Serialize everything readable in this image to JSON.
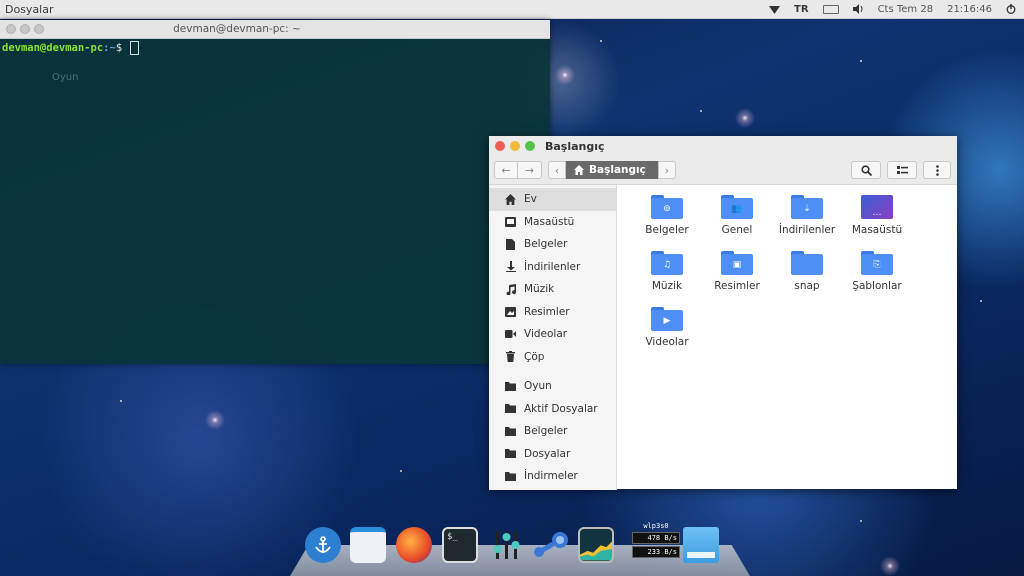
{
  "top_panel": {
    "app_title": "Dosyalar",
    "keyboard_layout": "TR",
    "date": "Cts Tem 28",
    "time": "21:16:46",
    "icons": [
      "wifi-icon",
      "battery-icon",
      "volume-icon",
      "power-icon"
    ]
  },
  "terminal": {
    "title": "devman@devman-pc: ~",
    "prompt_user": "devman@devman-pc",
    "prompt_path": ":~",
    "prompt_symbol": "$",
    "ghost_label": "Oyun"
  },
  "file_manager": {
    "title": "Başlangıç",
    "breadcrumb": "Başlangıç",
    "sidebar": [
      {
        "label": "Ev",
        "icon": "home-icon",
        "active": true
      },
      {
        "label": "Masaüstü",
        "icon": "desktop-icon"
      },
      {
        "label": "Belgeler",
        "icon": "document-icon"
      },
      {
        "label": "İndirilenler",
        "icon": "download-icon"
      },
      {
        "label": "Müzik",
        "icon": "music-icon"
      },
      {
        "label": "Resimler",
        "icon": "image-icon"
      },
      {
        "label": "Videolar",
        "icon": "video-icon"
      },
      {
        "label": "Çöp",
        "icon": "trash-icon"
      },
      {
        "label": "Oyun",
        "icon": "folder-icon"
      },
      {
        "label": "Aktif Dosyalar",
        "icon": "folder-icon"
      },
      {
        "label": "Belgeler",
        "icon": "folder-icon"
      },
      {
        "label": "Dosyalar",
        "icon": "folder-icon"
      },
      {
        "label": "İndirmeler",
        "icon": "folder-icon"
      }
    ],
    "files": [
      {
        "label": "Belgeler",
        "icon": "document-folder-icon"
      },
      {
        "label": "Genel",
        "icon": "public-folder-icon"
      },
      {
        "label": "İndirilenler",
        "icon": "download-folder-icon"
      },
      {
        "label": "Masaüstü",
        "icon": "desktop-folder-icon"
      },
      {
        "label": "Müzik",
        "icon": "music-folder-icon"
      },
      {
        "label": "Resimler",
        "icon": "pictures-folder-icon"
      },
      {
        "label": "snap",
        "icon": "folder-icon"
      },
      {
        "label": "Şablonlar",
        "icon": "templates-folder-icon"
      },
      {
        "label": "Videolar",
        "icon": "video-folder-icon"
      }
    ]
  },
  "dock": {
    "items": [
      "anchor-icon",
      "files-icon",
      "firefox-icon",
      "terminal-icon",
      "settings-icon",
      "steam-icon",
      "system-monitor-icon",
      "network-monitor",
      "trash-icon"
    ],
    "network": {
      "interface": "wlp3s0",
      "down": "478 B/s",
      "up": "233 B/s"
    }
  },
  "colors": {
    "folder": "#4e8ff5",
    "prompt_user": "#8ae234",
    "prompt_path": "#729fcf"
  }
}
